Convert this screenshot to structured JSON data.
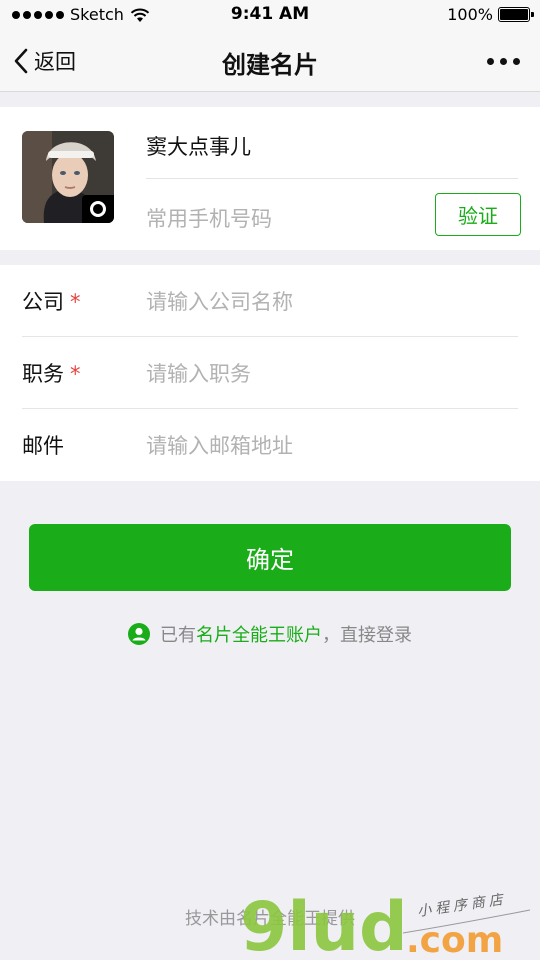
{
  "status_bar": {
    "carrier": "Sketch",
    "time": "9:41 AM",
    "battery": "100%"
  },
  "nav": {
    "back_label": "返回",
    "title": "创建名片"
  },
  "profile": {
    "name": "窦大点事儿",
    "phone_placeholder": "常用手机号码",
    "verify_label": "验证"
  },
  "form": {
    "rows": [
      {
        "label": "公司",
        "required": "*",
        "placeholder": "请输入公司名称"
      },
      {
        "label": "职务",
        "required": "*",
        "placeholder": "请输入职务"
      },
      {
        "label": "邮件",
        "required": "",
        "placeholder": "请输入邮箱地址"
      }
    ]
  },
  "confirm_label": "确定",
  "login_hint": {
    "prefix": "已有",
    "link": "名片全能王账户",
    "suffix": "，直接登录"
  },
  "footer": "技术由名片全能王提供",
  "watermark": {
    "logo": "9lud",
    "com": ".com",
    "tag": "小程序商店"
  },
  "colors": {
    "accent": "#1aad19",
    "required": "#e64340",
    "background": "#efeff4"
  }
}
